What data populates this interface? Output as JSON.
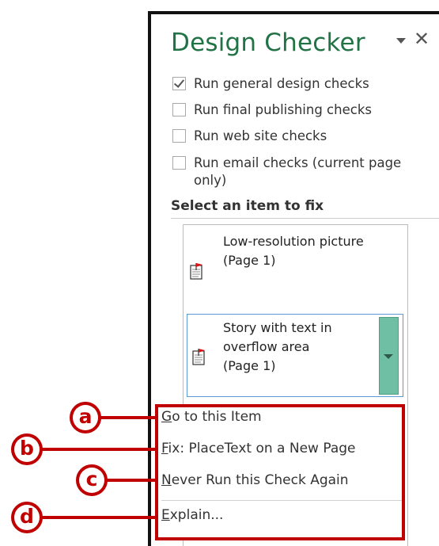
{
  "pane": {
    "title": "Design Checker",
    "close_glyph": "✕"
  },
  "options": [
    {
      "label": "Run general design checks",
      "checked": true
    },
    {
      "label": "Run final publishing checks",
      "checked": false
    },
    {
      "label": "Run web site checks",
      "checked": false
    },
    {
      "label_line1": "Run email checks (current page",
      "label_line2": "only)",
      "checked": false
    }
  ],
  "section_heading": "Select an item to fix",
  "items": [
    {
      "line1": "Low-resolution picture",
      "line2": "(Page 1)",
      "icon": "document-flag-icon"
    },
    {
      "line1": "Story with text in",
      "line2": "overflow area",
      "line3": "(Page 1)",
      "icon": "document-flag-icon"
    }
  ],
  "context_menu": [
    {
      "accel": "G",
      "rest": "o to this Item"
    },
    {
      "accel": "F",
      "rest": "ix: PlaceText on a New Page"
    },
    {
      "accel": "N",
      "rest": "ever Run this Check Again"
    },
    {
      "accel": "E",
      "rest": "xplain..."
    }
  ],
  "callouts": [
    "a",
    "b",
    "c",
    "d"
  ],
  "colors": {
    "title": "#217346",
    "callout": "#c00000",
    "dropdown": "#6fbfa5",
    "selection_border": "#5b9bd5"
  }
}
